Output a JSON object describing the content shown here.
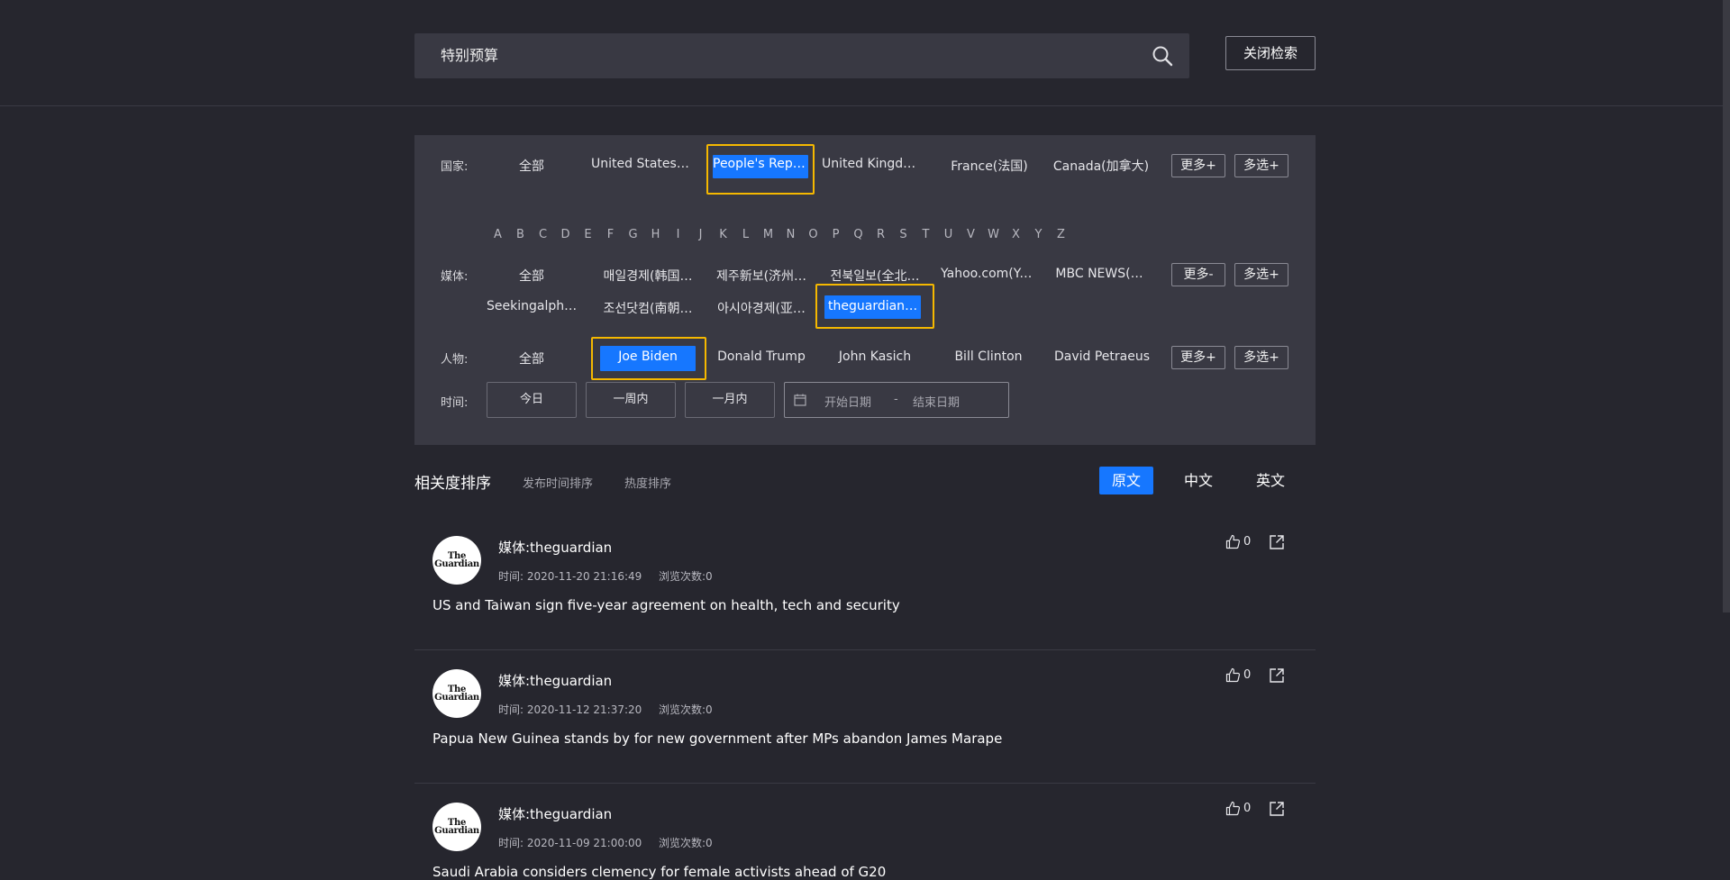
{
  "search": {
    "value": "特别预算",
    "close_label": "关闭检索"
  },
  "filters": {
    "country": {
      "label": "国家:",
      "options": [
        "全部",
        "United States …",
        "People's Repu…",
        "United Kingdo…",
        "France(法国)",
        "Canada(加拿大)"
      ],
      "selected": "People's Repu…",
      "more_label": "更多+",
      "multi_label": "多选+"
    },
    "letters": [
      "A",
      "B",
      "C",
      "D",
      "E",
      "F",
      "G",
      "H",
      "I",
      "J",
      "K",
      "L",
      "M",
      "N",
      "O",
      "P",
      "Q",
      "R",
      "S",
      "T",
      "U",
      "V",
      "W",
      "X",
      "Y",
      "Z"
    ],
    "media": {
      "label": "媒体:",
      "options_row1": [
        "全部",
        "매일경제(韩国…",
        "제주新보(济州…",
        "전북일보(全北…",
        "Yahoo.com(Ya…",
        "MBC NEWS(…"
      ],
      "options_row2": [
        "Seekingalpha.…",
        "조선닷컴(南朝…",
        "아시아경제(亚…",
        "theguardian(…"
      ],
      "selected": "theguardian(…",
      "more_label": "更多-",
      "multi_label": "多选+"
    },
    "person": {
      "label": "人物:",
      "options": [
        "全部",
        "Joe Biden",
        "Donald Trump",
        "John Kasich",
        "Bill Clinton",
        "David Petraeus"
      ],
      "selected": "Joe Biden",
      "more_label": "更多+",
      "multi_label": "多选+"
    },
    "time": {
      "label": "时间:",
      "options": [
        "今日",
        "一周内",
        "一月内"
      ],
      "start_placeholder": "开始日期",
      "separator": "-",
      "end_placeholder": "结束日期"
    }
  },
  "sort": {
    "relevance": "相关度排序",
    "by_time": "发布时间排序",
    "by_heat": "热度排序",
    "langs": [
      "原文",
      "中文",
      "英文"
    ],
    "active_lang": "原文"
  },
  "articles": [
    {
      "logo_text": "The Guardian",
      "media": "媒体:theguardian",
      "time": "时间: 2020-11-20 21:16:49",
      "views": "浏览次数:0",
      "likes": "0",
      "title": "US and Taiwan sign five-year agreement on health, tech and security"
    },
    {
      "logo_text": "The Guardian",
      "media": "媒体:theguardian",
      "time": "时间: 2020-11-12 21:37:20",
      "views": "浏览次数:0",
      "likes": "0",
      "title": "Papua New Guinea stands by for new government after MPs abandon James Marape"
    },
    {
      "logo_text": "The Guardian",
      "media": "媒体:theguardian",
      "time": "时间: 2020-11-09 21:00:00",
      "views": "浏览次数:0",
      "likes": "0",
      "title": "Saudi Arabia considers clemency for female activists ahead of G20"
    }
  ],
  "colors": {
    "background": "#26262e",
    "panel": "#393943",
    "accent": "#1677ff",
    "highlight": "#f5b800"
  }
}
